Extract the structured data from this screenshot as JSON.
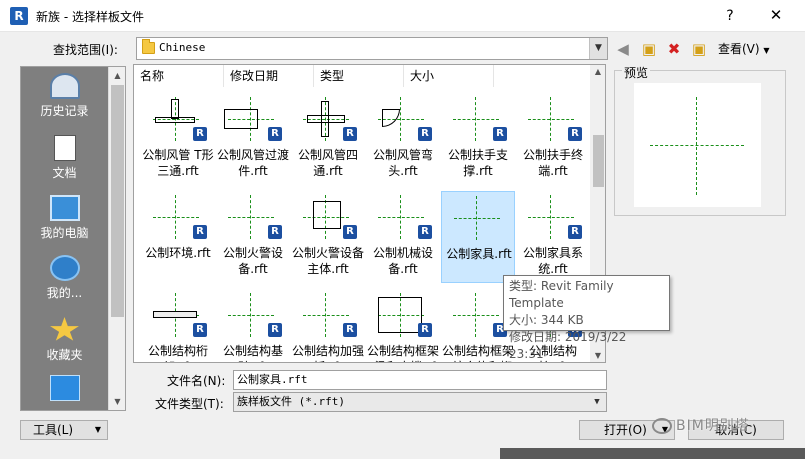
{
  "window": {
    "title": "新族 - 选择样板文件",
    "app_icon": "R",
    "help_glyph": "?",
    "close_glyph": "✕"
  },
  "toolbar": {
    "look_in_label": "查找范围(I):",
    "look_in_value": "Chinese",
    "views_label": "查看(V)"
  },
  "places": [
    {
      "label": "历史记录",
      "icon": "history-icon"
    },
    {
      "label": "文档",
      "icon": "documents-icon"
    },
    {
      "label": "我的电脑",
      "icon": "computer-icon"
    },
    {
      "label": "我的...",
      "icon": "network-icon"
    },
    {
      "label": "收藏夹",
      "icon": "favorites-icon"
    },
    {
      "label": "",
      "icon": "desktop-icon"
    }
  ],
  "columns": [
    "名称",
    "修改日期",
    "类型",
    "大小"
  ],
  "files": [
    {
      "name": "公制风管 T形三通.rft"
    },
    {
      "name": "公制风管过渡件.rft"
    },
    {
      "name": "公制风管四通.rft"
    },
    {
      "name": "公制风管弯头.rft"
    },
    {
      "name": "公制扶手支撑.rft"
    },
    {
      "name": "公制扶手终端.rft"
    },
    {
      "name": "公制环境.rft"
    },
    {
      "name": "公制火警设备.rft"
    },
    {
      "name": "公制火警设备主体.rft"
    },
    {
      "name": "公制机械设备.rft"
    },
    {
      "name": "公制家具.rft",
      "selected": true
    },
    {
      "name": "公制家具系统.rft"
    },
    {
      "name": "公制结构桁架.rft"
    },
    {
      "name": "公制结构基础.rft"
    },
    {
      "name": "公制结构加强板.rft"
    },
    {
      "name": "公制结构框架 - 梁和支撑.rft"
    },
    {
      "name": "公制结构框架 - 综合体和桁架.rft"
    },
    {
      "name": "公制结构柱.rft"
    }
  ],
  "preview": {
    "label": "预览"
  },
  "tooltip": {
    "type_line": "类型: Revit Family Template",
    "size_line": "大小: 344 KB",
    "date_line": "修改日期: 2019/3/22 23:31"
  },
  "form": {
    "filename_label": "文件名(N):",
    "filename_value": "公制家具.rft",
    "filetype_label": "文件类型(T):",
    "filetype_value": "族样板文件 (*.rft)"
  },
  "buttons": {
    "tools": "工具(L)",
    "open": "打开(O)",
    "cancel": "取消(C)"
  },
  "watermark": "BIM明别塔",
  "colors": {
    "selection": "#cce8ff",
    "reference_line": "#1a8f1a",
    "revit_badge": "#1c4fa0",
    "places_bg": "#7f7f7f"
  }
}
